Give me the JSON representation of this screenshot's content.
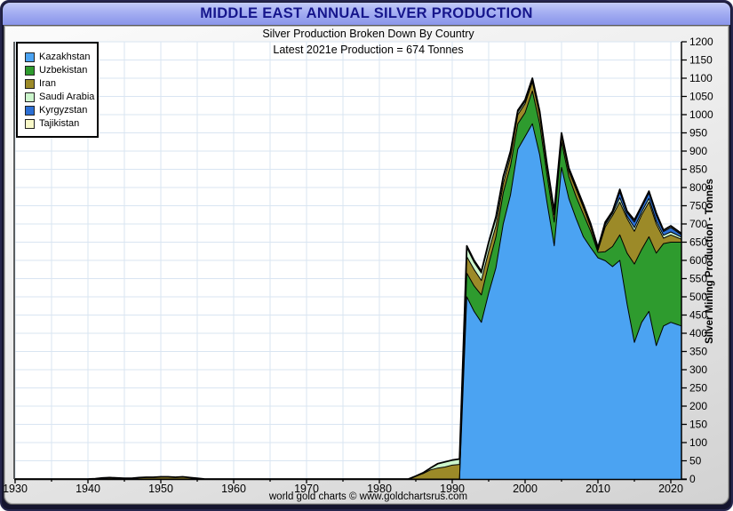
{
  "chart_data": {
    "type": "area",
    "stacked": true,
    "title": "MIDDLE EAST ANNUAL SILVER PRODUCTION",
    "subtitle": "Silver Production Broken Down By Country",
    "annotation": "Latest 2021e Production = 674 Tonnes",
    "ylabel": "Silver Mining Production - Tonnes",
    "footer": "world gold charts © www.goldchartsrus.com",
    "latest_year": "2021e",
    "latest_total_tonnes": 674,
    "ylim": [
      0,
      1200
    ],
    "ytick_step": 50,
    "xticks": [
      1930,
      1940,
      1950,
      1960,
      1970,
      1980,
      1990,
      2000,
      2010,
      2020
    ],
    "grid": true,
    "legend_position": "top-left",
    "colors": {
      "title_text": "#16168c",
      "titlebar": "#a4aef2",
      "plot_background": "#ffffff",
      "gridline": "#d9e5f2",
      "outline": "#000000"
    },
    "x": [
      1930,
      1931,
      1932,
      1933,
      1934,
      1935,
      1936,
      1937,
      1938,
      1939,
      1940,
      1941,
      1942,
      1943,
      1944,
      1945,
      1946,
      1947,
      1948,
      1949,
      1950,
      1951,
      1952,
      1953,
      1954,
      1955,
      1956,
      1957,
      1958,
      1959,
      1960,
      1961,
      1962,
      1963,
      1964,
      1965,
      1966,
      1967,
      1968,
      1969,
      1970,
      1971,
      1972,
      1973,
      1974,
      1975,
      1976,
      1977,
      1978,
      1979,
      1980,
      1981,
      1982,
      1983,
      1984,
      1985,
      1986,
      1987,
      1988,
      1989,
      1990,
      1991,
      1992,
      1993,
      1994,
      1995,
      1996,
      1997,
      1998,
      1999,
      2000,
      2001,
      2002,
      2003,
      2004,
      2005,
      2006,
      2007,
      2008,
      2009,
      2010,
      2011,
      2012,
      2013,
      2014,
      2015,
      2016,
      2017,
      2018,
      2019,
      2020,
      2021
    ],
    "series": [
      {
        "name": "Kazakhstan",
        "color": "#4BA3F2",
        "values": [
          0,
          0,
          0,
          0,
          0,
          0,
          0,
          0,
          0,
          0,
          0,
          0,
          0,
          0,
          0,
          0,
          0,
          0,
          0,
          0,
          0,
          0,
          0,
          0,
          0,
          0,
          0,
          0,
          0,
          0,
          0,
          0,
          0,
          0,
          0,
          0,
          0,
          0,
          0,
          0,
          0,
          0,
          0,
          0,
          0,
          0,
          0,
          0,
          0,
          0,
          0,
          0,
          0,
          0,
          0,
          0,
          0,
          0,
          0,
          0,
          0,
          0,
          500,
          460,
          430,
          510,
          580,
          700,
          780,
          905,
          940,
          975,
          890,
          760,
          640,
          855,
          770,
          715,
          665,
          635,
          607,
          599,
          583,
          600,
          480,
          375,
          430,
          460,
          366,
          420,
          430,
          420
        ]
      },
      {
        "name": "Uzbekistan",
        "color": "#2E9B2E",
        "values": [
          0,
          0,
          0,
          0,
          0,
          0,
          0,
          0,
          0,
          0,
          0,
          0,
          0,
          0,
          0,
          0,
          0,
          0,
          0,
          0,
          0,
          0,
          0,
          0,
          0,
          0,
          0,
          0,
          0,
          0,
          0,
          0,
          0,
          0,
          0,
          0,
          0,
          0,
          0,
          0,
          0,
          0,
          0,
          0,
          0,
          0,
          0,
          0,
          0,
          0,
          0,
          0,
          0,
          0,
          0,
          0,
          0,
          0,
          0,
          0,
          0,
          0,
          65,
          70,
          75,
          80,
          85,
          85,
          80,
          70,
          65,
          90,
          85,
          75,
          65,
          70,
          60,
          60,
          62,
          45,
          15,
          25,
          55,
          70,
          140,
          215,
          200,
          205,
          254,
          226,
          220,
          230
        ]
      },
      {
        "name": "Iran",
        "color": "#9C8A28",
        "values": [
          0,
          0,
          0,
          0,
          0,
          0,
          0,
          0,
          0,
          0,
          0,
          1,
          3,
          4,
          3,
          2,
          2,
          4,
          5,
          5,
          6,
          6,
          5,
          6,
          4,
          2,
          0,
          0,
          0,
          0,
          0,
          0,
          0,
          0,
          0,
          0,
          0,
          0,
          0,
          0,
          0,
          0,
          0,
          0,
          0,
          0,
          0,
          0,
          0,
          0,
          0,
          0,
          0,
          0,
          0,
          8,
          15,
          25,
          30,
          33,
          38,
          40,
          45,
          45,
          40,
          35,
          30,
          25,
          25,
          25,
          25,
          25,
          25,
          20,
          20,
          15,
          15,
          20,
          18,
          12,
          5,
          68,
          85,
          90,
          95,
          90,
          95,
          95,
          80,
          15,
          20,
          8
        ]
      },
      {
        "name": "Saudi Arabia",
        "color": "#CCF6CC",
        "values": [
          0,
          0,
          0,
          0,
          0,
          0,
          0,
          0,
          0,
          0,
          0,
          0,
          0,
          0,
          0,
          0,
          0,
          0,
          0,
          0,
          0,
          0,
          0,
          0,
          0,
          0,
          0,
          0,
          0,
          0,
          0,
          0,
          0,
          0,
          0,
          0,
          0,
          0,
          0,
          0,
          0,
          0,
          0,
          0,
          0,
          0,
          0,
          0,
          0,
          0,
          0,
          0,
          0,
          0,
          0,
          0,
          2,
          5,
          12,
          14,
          14,
          15,
          25,
          20,
          20,
          20,
          20,
          15,
          10,
          7,
          6,
          5,
          5,
          5,
          5,
          5,
          4,
          4,
          4,
          4,
          3,
          6,
          6,
          12,
          6,
          10,
          8,
          10,
          8,
          8,
          8,
          6
        ]
      },
      {
        "name": "Kyrgyzstan",
        "color": "#2C6FD4",
        "values": [
          0,
          0,
          0,
          0,
          0,
          0,
          0,
          0,
          0,
          0,
          0,
          0,
          0,
          0,
          0,
          0,
          0,
          0,
          0,
          0,
          0,
          0,
          0,
          0,
          0,
          0,
          0,
          0,
          0,
          0,
          0,
          0,
          0,
          0,
          0,
          0,
          0,
          0,
          0,
          0,
          0,
          0,
          0,
          0,
          0,
          0,
          0,
          0,
          0,
          0,
          0,
          0,
          0,
          0,
          0,
          0,
          0,
          0,
          0,
          0,
          0,
          0,
          3,
          3,
          3,
          3,
          3,
          3,
          3,
          3,
          3,
          3,
          3,
          3,
          3,
          3,
          3,
          3,
          3,
          3,
          3,
          5,
          4,
          15,
          10,
          15,
          12,
          15,
          16,
          10,
          12,
          6
        ]
      },
      {
        "name": "Tajikistan",
        "color": "#F8F8C8",
        "values": [
          0,
          0,
          0,
          0,
          0,
          0,
          0,
          0,
          0,
          0,
          0,
          0,
          0,
          0,
          0,
          0,
          0,
          0,
          0,
          0,
          0,
          0,
          0,
          0,
          0,
          0,
          0,
          0,
          0,
          0,
          0,
          0,
          0,
          0,
          0,
          0,
          0,
          0,
          0,
          0,
          0,
          0,
          0,
          0,
          0,
          0,
          0,
          0,
          0,
          0,
          0,
          0,
          0,
          0,
          0,
          0,
          0,
          0,
          0,
          0,
          0,
          0,
          2,
          2,
          2,
          2,
          2,
          2,
          2,
          2,
          2,
          2,
          2,
          2,
          2,
          2,
          2,
          2,
          2,
          2,
          2,
          2,
          2,
          8,
          4,
          6,
          5,
          5,
          6,
          4,
          5,
          4
        ]
      }
    ]
  }
}
